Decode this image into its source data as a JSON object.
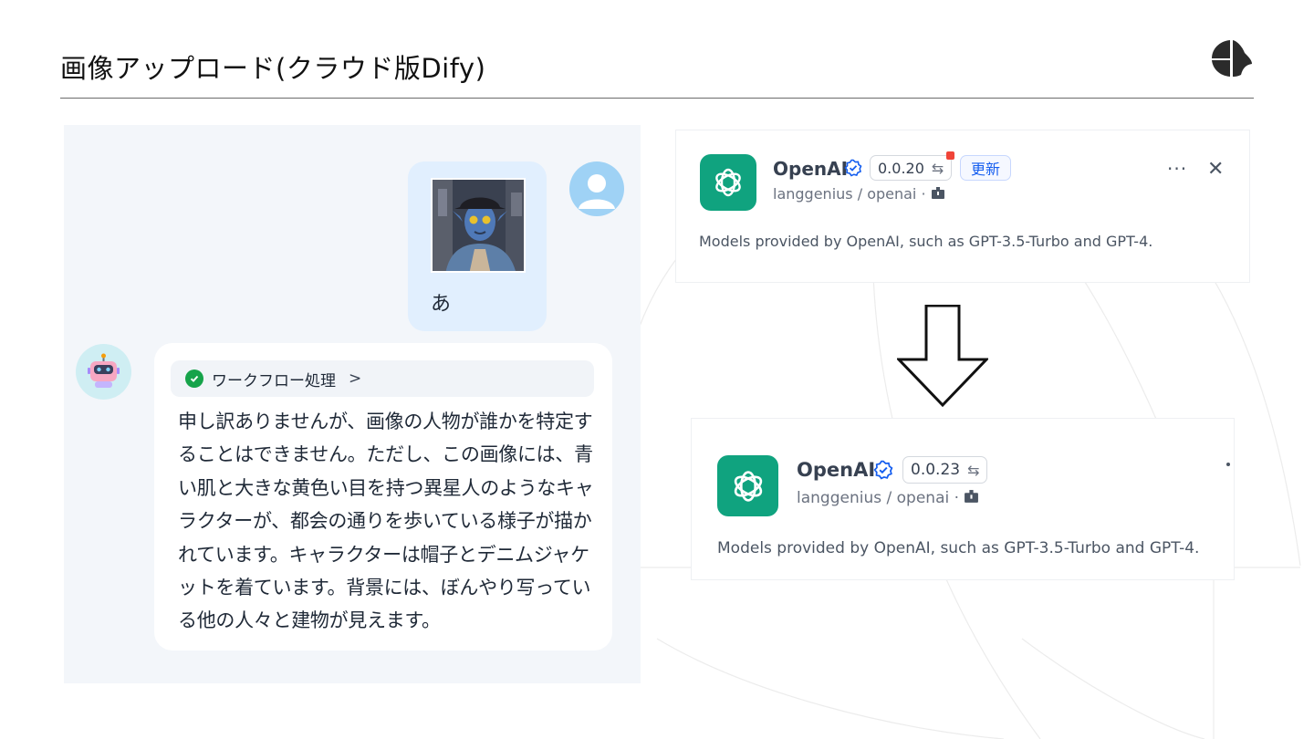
{
  "slide": {
    "title": "画像アップロード(クラウド版Dify)"
  },
  "chat": {
    "user_message": "あ",
    "workflow_label": "ワークフロー処理",
    "workflow_chevron": ">",
    "bot_reply": "申し訳ありませんが、画像の人物が誰かを特定することはできません。ただし、この画像には、青い肌と大きな黄色い目を持つ異星人のようなキャラクターが、都会の通りを歩いている様子が描かれています。キャラクターは帽子とデニムジャケットを着ています。背景には、ぼんやり写っている他の人々と建物が見えます。"
  },
  "plugin_before": {
    "name": "OpenAI",
    "version": "0.0.20",
    "update_label": "更新",
    "org": "langgenius",
    "repo": "openai",
    "description": "Models provided by OpenAI, such as GPT-3.5-Turbo and GPT-4.",
    "more_label": "···",
    "close_label": "✕"
  },
  "plugin_after": {
    "name": "OpenAI",
    "version": "0.0.23",
    "org": "langgenius",
    "repo": "openai",
    "description": "Models provided by OpenAI, such as GPT-3.5-Turbo and GPT-4."
  },
  "colors": {
    "openai_green": "#10a37f",
    "verified_blue": "#155eef",
    "update_blue": "#155eef",
    "notification_red": "#f04438",
    "check_green": "#16a34a",
    "user_bubble": "#e1effe",
    "chat_background": "#f3f6fa"
  },
  "icons": {
    "brand": "brand-logo-icon",
    "check": "check-circle-icon",
    "verified": "verified-badge-icon",
    "swap": "swap-arrows-icon",
    "package": "package-icon",
    "arrow": "down-arrow-icon"
  }
}
